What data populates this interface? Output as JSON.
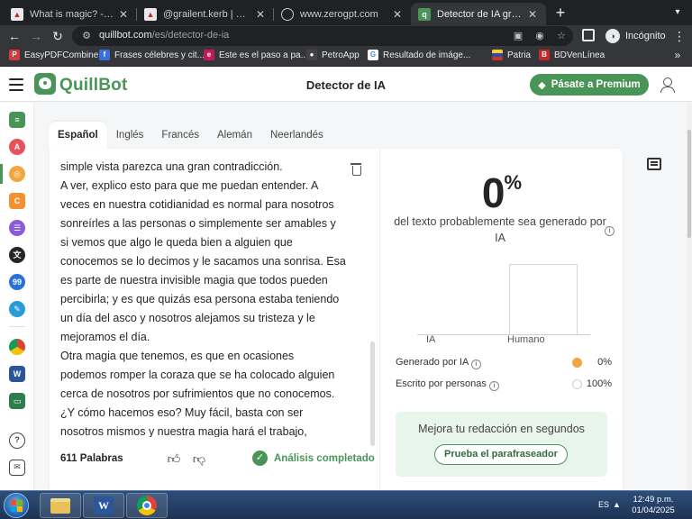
{
  "browser": {
    "tabs": [
      {
        "title": "What is magic? - ¿Qué es",
        "active": false,
        "favicon": "peakd-icon"
      },
      {
        "title": "@grailent.kerb | PeakD",
        "active": false,
        "favicon": "peakd-icon"
      },
      {
        "title": "www.zerogpt.com",
        "active": false,
        "favicon": "globe-icon"
      },
      {
        "title": "Detector de IA gratuito | Q",
        "active": true,
        "favicon": "quillbot-icon"
      }
    ],
    "url_host": "quillbot.com",
    "url_path": "/es/detector-de-ia",
    "incognito_label": "Incógnito",
    "bookmarks": [
      {
        "label": "EasyPDFCombine",
        "color": "#d23b3b"
      },
      {
        "label": "Frases célebres y cit...",
        "color": "#3a6ed8"
      },
      {
        "label": "Este es el paso a pa...",
        "color": "#c2185b"
      },
      {
        "label": "PetroApp",
        "color": "#444444"
      },
      {
        "label": "Resultado de imáge...",
        "color": "#4285f4"
      },
      {
        "label": "Patria",
        "color": "#e0a800"
      },
      {
        "label": "BDVenLínea",
        "color": "#c62828"
      }
    ]
  },
  "app": {
    "brand": "QuillBot",
    "page_title": "Detector de IA",
    "premium_label": "Pásate a Premium",
    "accent_color": "#499557"
  },
  "language_tabs": [
    {
      "label": "Español",
      "active": true
    },
    {
      "label": "Inglés",
      "active": false
    },
    {
      "label": "Francés",
      "active": false
    },
    {
      "label": "Alemán",
      "active": false
    },
    {
      "label": "Neerlandés",
      "active": false
    }
  ],
  "editor": {
    "text_lines": [
      "simple vista parezca una gran contradicción.",
      "A ver, explico esto para que me puedan entender. A",
      "veces en nuestra cotidianidad es normal para nosotros",
      "sonreírles a las personas o simplemente ser amables y",
      "si vemos que algo le queda bien a alguien que",
      "conocemos se lo decimos y le sacamos una sonrisa. Esa",
      "es parte de nuestra invisible magia que todos pueden",
      "percibirla; y es que quizás esa persona estaba teniendo",
      "un día del asco y nosotros alejamos su tristeza y le",
      "mejoramos el día.",
      "Otra magia que tenemos, es que en ocasiones",
      "podemos romper la coraza que se ha colocado alguien",
      "cerca de nosotros por sufrimientos que no conocemos.",
      "¿Y cómo hacemos eso? Muy fácil, basta con ser",
      "nosotros mismos y nuestra magia hará el trabajo,"
    ],
    "word_count": "611 Palabras",
    "status": "Análisis completado"
  },
  "result": {
    "percent_value": "0",
    "percent_sign": "%",
    "percent_label": "del texto probablemente sea generado por IA",
    "chart": {
      "type": "bar",
      "categories": [
        "IA",
        "Humano"
      ],
      "values": [
        0,
        100
      ],
      "ylim": [
        0,
        100
      ]
    },
    "legend": [
      {
        "label": "Generado por IA",
        "value": "0%",
        "color": "#f2a640"
      },
      {
        "label": "Escrito por personas",
        "value": "100%",
        "color": "#ffffff"
      }
    ],
    "promo_text": "Mejora tu redacción en segundos",
    "promo_button": "Prueba el parafraseador"
  },
  "taskbar": {
    "lang": "ES",
    "time": "12:49 p.m.",
    "date": "01/04/2025"
  }
}
